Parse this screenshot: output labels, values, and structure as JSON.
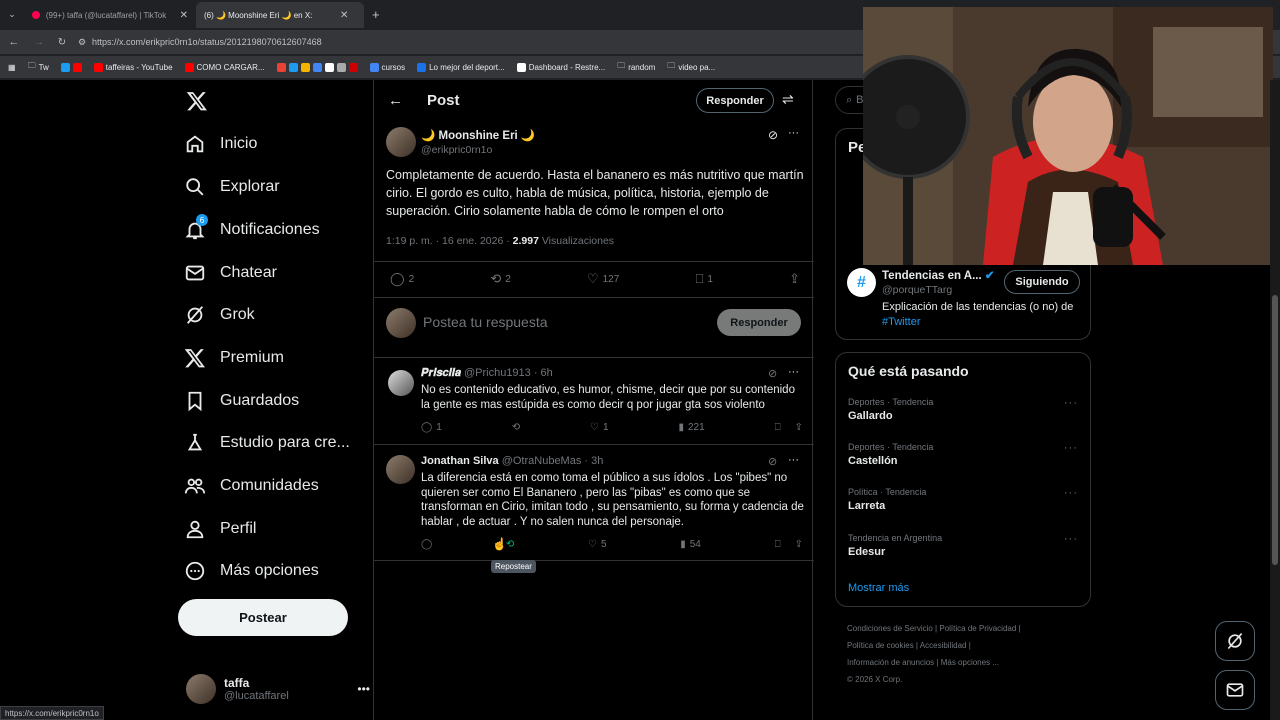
{
  "browser": {
    "tabs": [
      {
        "label": "(99+) taffa (@lucataffarel) | TikTok"
      },
      {
        "label": "(6) 🌙 Moonshine Eri 🌙 en X:"
      }
    ],
    "url": "https://x.com/erikpric0rn1o/status/2012198070612607468",
    "bookmarks": [
      "Tw",
      "taffeiras - YouTube",
      "COMO CARGAR...",
      "cursos",
      "Lo mejor del deport...",
      "Dashboard - Restre...",
      "random",
      "video pa..."
    ],
    "status_url": "https://x.com/erikpric0rn1o"
  },
  "nav": {
    "items": [
      "Inicio",
      "Explorar",
      "Notificaciones",
      "Chatear",
      "Grok",
      "Premium",
      "Guardados",
      "Estudio para cre...",
      "Comunidades",
      "Perfil",
      "Más opciones"
    ],
    "notif_badge": "6",
    "post_button": "Postear",
    "user_name": "taffa",
    "user_handle": "@lucataffarel"
  },
  "post": {
    "header_title": "Post",
    "reply_button": "Responder",
    "author_name": "🌙 Moonshine Eri 🌙",
    "author_handle": "@erikpric0rn1o",
    "text": "Completamente de acuerdo. Hasta el bananero es más nutritivo que martín cirio. El gordo es culto, habla de música, política, historia, ejemplo de superación.  Cirio solamente habla de cómo le rompen el orto",
    "time": "1:19 p. m. · 16 ene. 2026 · ",
    "views_count": "2.997",
    "views_label": " Visualizaciones",
    "replies": "2",
    "reposts": "2",
    "likes": "127",
    "bookmarks": "1",
    "compose_placeholder": "Postea tu respuesta",
    "compose_button": "Responder"
  },
  "replies": [
    {
      "name": "𝑷𝒓𝒊𝒔𝒄𝒊𝒍𝒂",
      "handle": "@Prichu1913 · 6h",
      "text": "No es contenido educativo, es humor, chisme, decir que por su contenido la gente es mas estúpida es como decir q por jugar gta sos violento",
      "replies": "1",
      "likes": "1",
      "views": "221"
    },
    {
      "name": "Jonathan Silva",
      "handle": "@OtraNubeMas · 3h",
      "text": "La diferencia está en como toma el público a sus ídolos . Los \"pibes\" no quieren ser como El Bananero , pero las \"pibas\" es como que se transforman en Cirio, imitan todo , su pensamiento, su forma y cadencia de hablar , de actuar . Y no salen nunca del personaje.",
      "likes": "5",
      "views": "54",
      "tooltip": "Repostear"
    }
  ],
  "right": {
    "search_placeholder": "B",
    "follow_title_partial": "Pe",
    "account_name": "Tendencias en A...",
    "account_handle": "@porqueTTarg",
    "account_bio": "Explicación de las tendencias (o no) de",
    "account_hashtag": "#Twitter",
    "follow_button": "Siguiendo",
    "trends_title": "Qué está pasando",
    "trends": [
      {
        "category": "Deportes · Tendencia",
        "name": "Gallardo"
      },
      {
        "category": "Deportes · Tendencia",
        "name": "Castellón"
      },
      {
        "category": "Política · Tendencia",
        "name": "Larreta"
      },
      {
        "category": "Tendencia en Argentina",
        "name": "Edesur"
      }
    ],
    "show_more": "Mostrar más",
    "footer": [
      "Condiciones de Servicio",
      "Política de Privacidad",
      "Política de cookies",
      "Accesibilidad",
      "Información de anuncios",
      "Más opciones ...",
      "© 2026 X Corp."
    ]
  },
  "colors": {
    "accent": "#1d9bf0",
    "repost_green": "#00ba7c",
    "background": "#000000",
    "border": "#2f3336"
  }
}
